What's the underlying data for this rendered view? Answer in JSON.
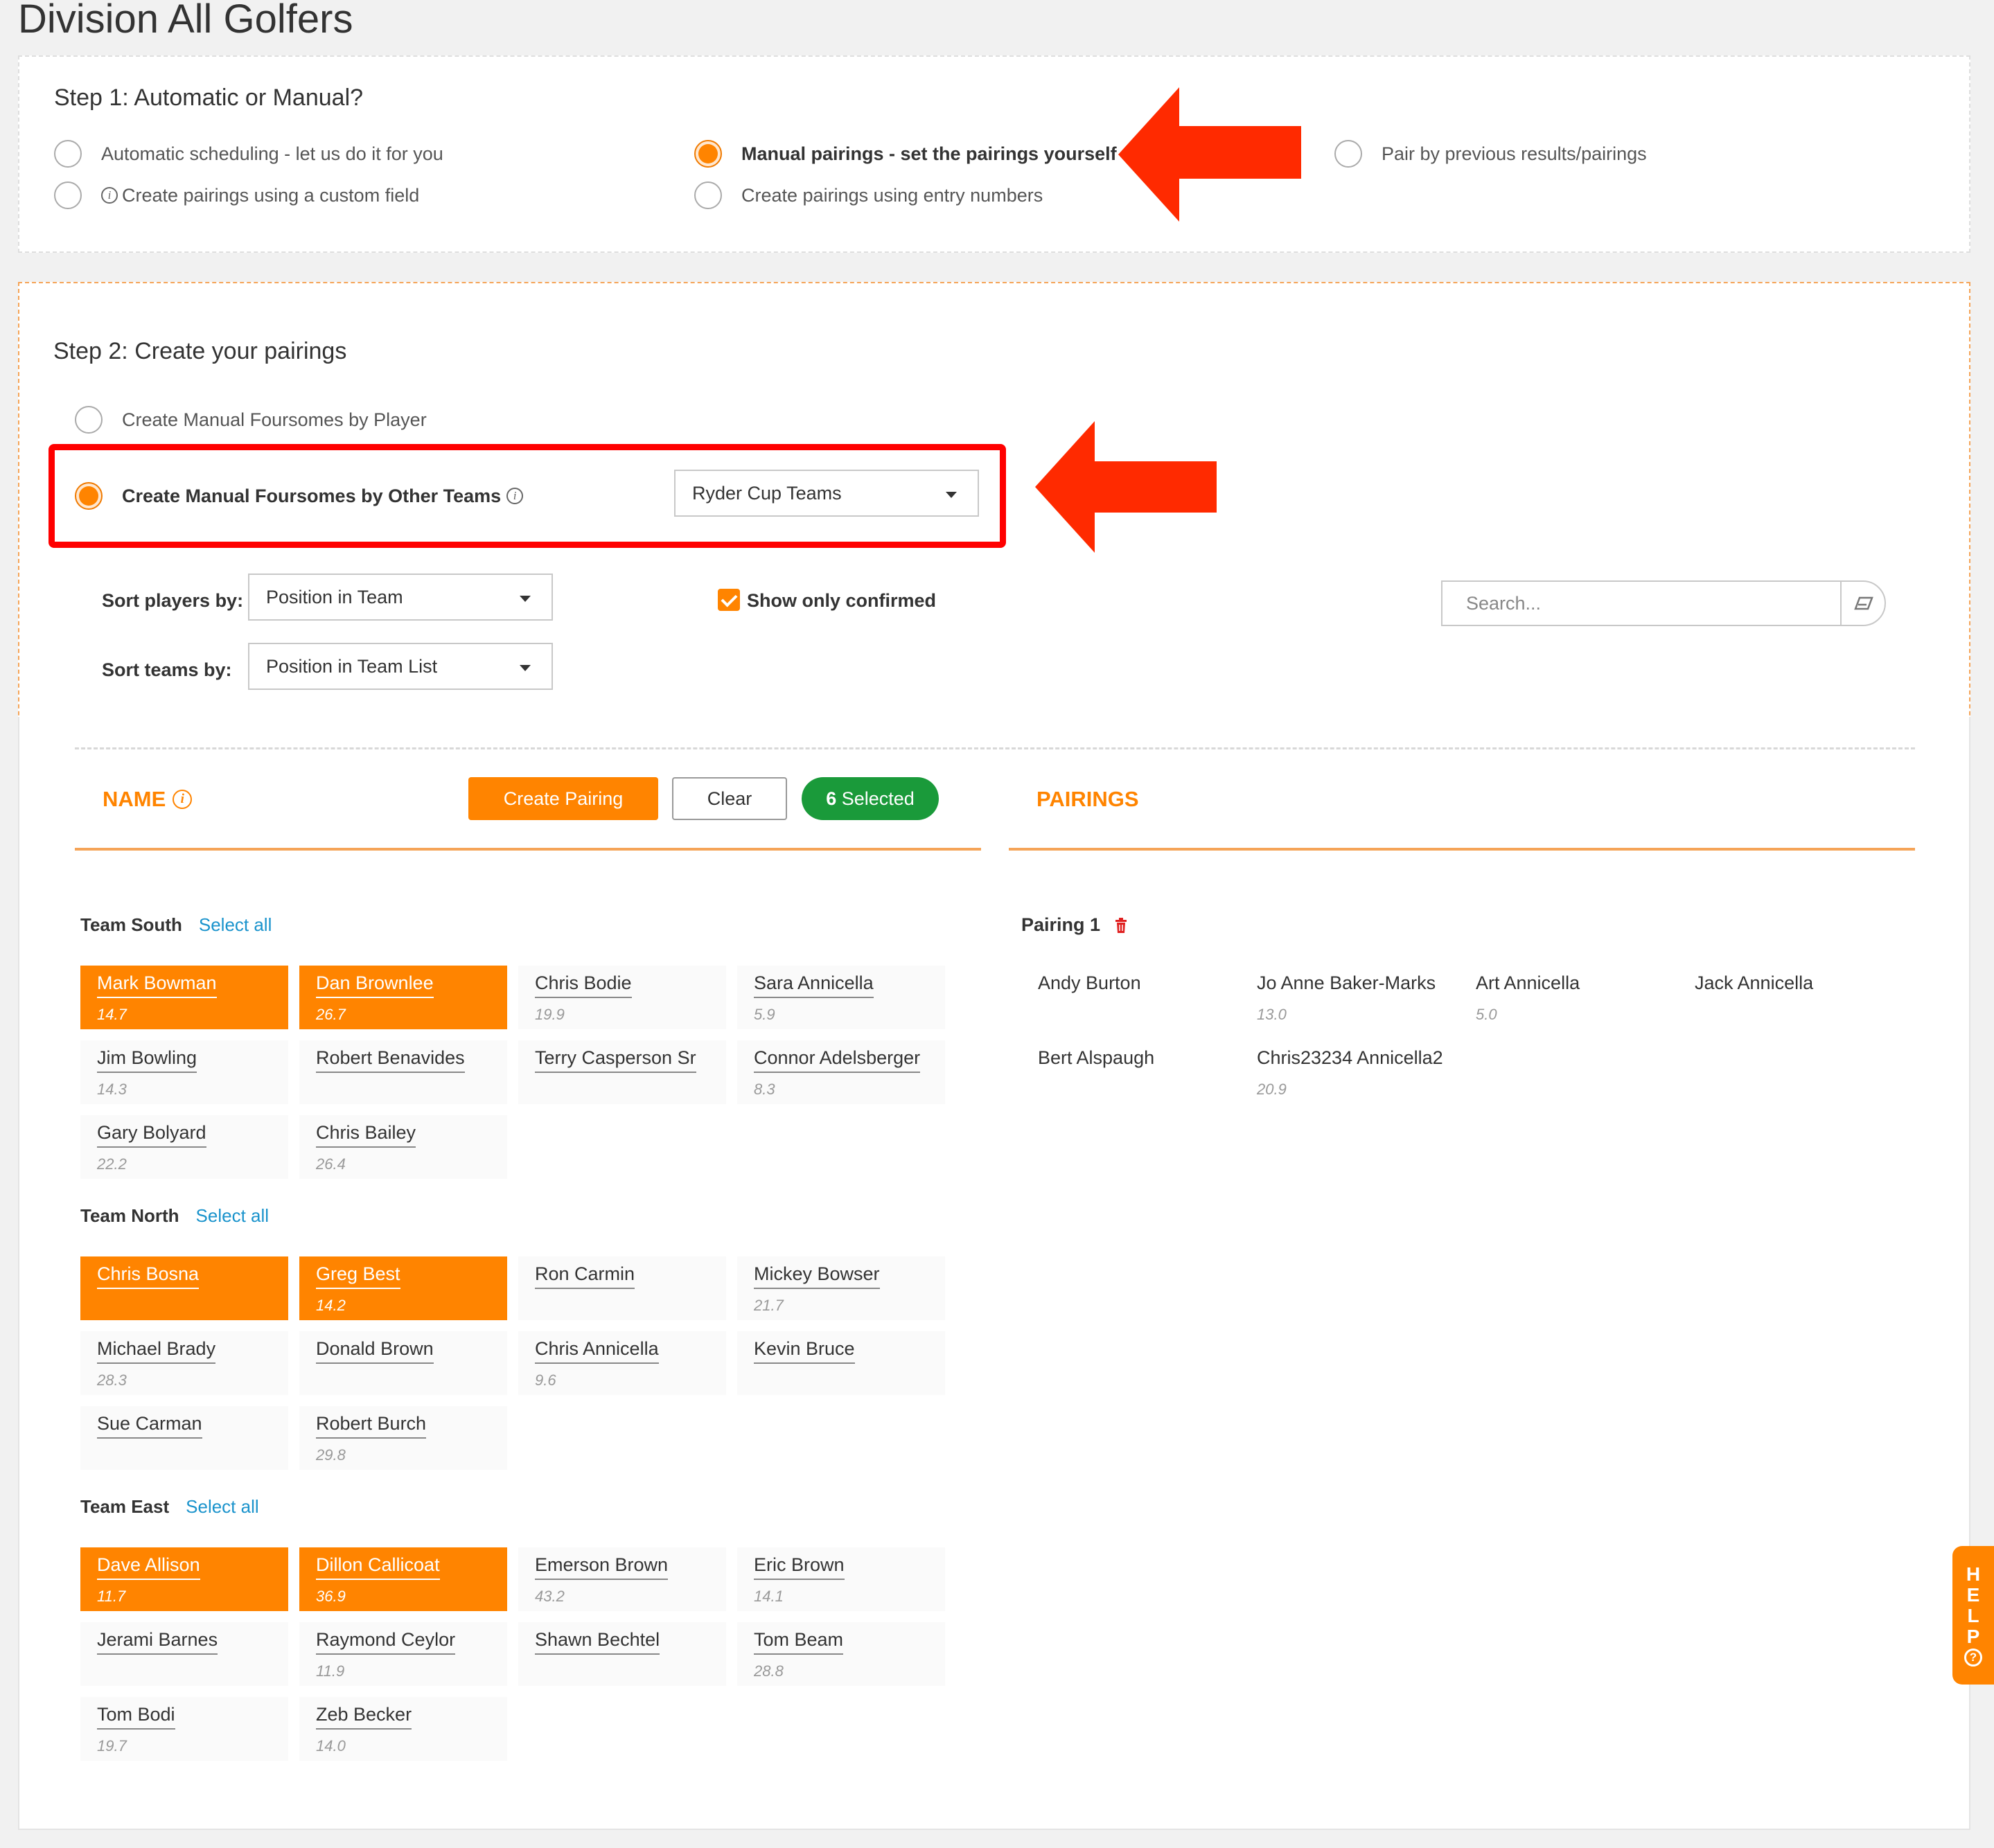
{
  "page": {
    "title": "Division All Golfers"
  },
  "step1": {
    "title": "Step 1: Automatic or Manual?",
    "options": [
      {
        "label": "Automatic scheduling - let us do it for you",
        "checked": false
      },
      {
        "label": "Create pairings using a custom field",
        "checked": false
      },
      {
        "label": "Manual pairings - set the pairings yourself",
        "checked": true
      },
      {
        "label": "Create pairings using entry numbers",
        "checked": false
      },
      {
        "label": "Pair by previous results/pairings",
        "checked": false
      }
    ]
  },
  "step2": {
    "title": "Step 2: Create your pairings",
    "options": [
      {
        "label": "Create Manual Foursomes by Player",
        "checked": false
      },
      {
        "label": "Create Manual Foursomes by Other Teams",
        "checked": true
      }
    ],
    "team_select": "Ryder Cup Teams",
    "sort_players_label": "Sort players by:",
    "sort_players_value": "Position in Team",
    "sort_teams_label": "Sort teams by:",
    "sort_teams_value": "Position in Team List",
    "show_confirmed_label": "Show only confirmed",
    "search_placeholder": "Search..."
  },
  "toolbar": {
    "name_header": "NAME",
    "create_label": "Create Pairing",
    "clear_label": "Clear",
    "selected_count": "6",
    "selected_label": "Selected",
    "pairings_header": "PAIRINGS"
  },
  "teams": [
    {
      "name": "Team South",
      "select_all": "Select all",
      "players": [
        {
          "name": "Mark Bowman",
          "hcp": "14.7",
          "selected": true
        },
        {
          "name": "Dan Brownlee",
          "hcp": "26.7",
          "selected": true
        },
        {
          "name": "Chris Bodie",
          "hcp": "19.9",
          "selected": false
        },
        {
          "name": "Sara Annicella",
          "hcp": "5.9",
          "selected": false
        },
        {
          "name": "Jim Bowling",
          "hcp": "14.3",
          "selected": false
        },
        {
          "name": "Robert Benavides",
          "hcp": "",
          "selected": false
        },
        {
          "name": "Terry Casperson Sr",
          "hcp": "",
          "selected": false
        },
        {
          "name": "Connor Adelsberger",
          "hcp": "8.3",
          "selected": false
        },
        {
          "name": "Gary Bolyard",
          "hcp": "22.2",
          "selected": false
        },
        {
          "name": "Chris Bailey",
          "hcp": "26.4",
          "selected": false
        }
      ]
    },
    {
      "name": "Team North",
      "select_all": "Select all",
      "players": [
        {
          "name": "Chris Bosna",
          "hcp": "",
          "selected": true
        },
        {
          "name": "Greg Best",
          "hcp": "14.2",
          "selected": true
        },
        {
          "name": "Ron Carmin",
          "hcp": "",
          "selected": false
        },
        {
          "name": "Mickey Bowser",
          "hcp": "21.7",
          "selected": false
        },
        {
          "name": "Michael Brady",
          "hcp": "28.3",
          "selected": false
        },
        {
          "name": "Donald Brown",
          "hcp": "",
          "selected": false
        },
        {
          "name": "Chris Annicella",
          "hcp": "9.6",
          "selected": false
        },
        {
          "name": "Kevin Bruce",
          "hcp": "",
          "selected": false
        },
        {
          "name": "Sue Carman",
          "hcp": "",
          "selected": false
        },
        {
          "name": "Robert Burch",
          "hcp": "29.8",
          "selected": false
        }
      ]
    },
    {
      "name": "Team East",
      "select_all": "Select all",
      "players": [
        {
          "name": "Dave Allison",
          "hcp": "11.7",
          "selected": true
        },
        {
          "name": "Dillon Callicoat",
          "hcp": "36.9",
          "selected": true
        },
        {
          "name": "Emerson Brown",
          "hcp": "43.2",
          "selected": false
        },
        {
          "name": "Eric Brown",
          "hcp": "14.1",
          "selected": false
        },
        {
          "name": "Jerami Barnes",
          "hcp": "",
          "selected": false
        },
        {
          "name": "Raymond Ceylor",
          "hcp": "11.9",
          "selected": false
        },
        {
          "name": "Shawn Bechtel",
          "hcp": "",
          "selected": false
        },
        {
          "name": "Tom Beam",
          "hcp": "28.8",
          "selected": false
        },
        {
          "name": "Tom Bodi",
          "hcp": "19.7",
          "selected": false
        },
        {
          "name": "Zeb Becker",
          "hcp": "14.0",
          "selected": false
        }
      ]
    }
  ],
  "pairings": [
    {
      "title": "Pairing 1",
      "players": [
        {
          "name": "Andy Burton",
          "hcp": ""
        },
        {
          "name": "Jo Anne Baker-Marks",
          "hcp": "13.0"
        },
        {
          "name": "Art Annicella",
          "hcp": "5.0"
        },
        {
          "name": "Jack Annicella",
          "hcp": ""
        },
        {
          "name": "Bert Alspaugh",
          "hcp": ""
        },
        {
          "name": "Chris23234 Annicella2",
          "hcp": "20.9"
        }
      ]
    }
  ],
  "help": {
    "letters": [
      "H",
      "E",
      "L",
      "P"
    ],
    "icon_glyph": "?"
  },
  "colors": {
    "accent": "#ff8400",
    "link": "#1a93cc",
    "success": "#1a9a3a",
    "annotation": "#ff2a00"
  }
}
